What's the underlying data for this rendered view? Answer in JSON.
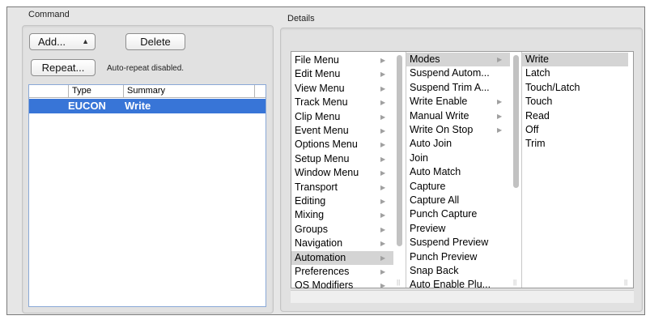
{
  "command": {
    "label": "Command",
    "add_label": "Add...",
    "delete_label": "Delete",
    "repeat_label": "Repeat...",
    "repeat_status": "Auto-repeat disabled.",
    "columns": [
      "Type",
      "Summary"
    ],
    "rows": [
      {
        "type": "EUCON",
        "summary": "Write"
      }
    ]
  },
  "details": {
    "label": "Details",
    "col1": [
      "File Menu",
      "Edit Menu",
      "View Menu",
      "Track Menu",
      "Clip Menu",
      "Event Menu",
      "Options Menu",
      "Setup Menu",
      "Window Menu",
      "Transport",
      "Editing",
      "Mixing",
      "Groups",
      "Navigation",
      "Automation",
      "Preferences",
      "OS Modifiers"
    ],
    "col2": [
      "Modes",
      "Suspend Autom...",
      "Suspend Trim A...",
      "Write Enable",
      "Manual Write",
      "Write On Stop",
      "Auto Join",
      "Join",
      "Auto Match",
      "Capture",
      "Capture All",
      "Punch Capture",
      "Preview",
      "Suspend Preview",
      "Punch Preview",
      "Snap Back",
      "Auto Enable Plu..."
    ],
    "col3": [
      "Write",
      "Latch",
      "Touch/Latch",
      "Touch",
      "Read",
      "Off",
      "Trim"
    ]
  }
}
